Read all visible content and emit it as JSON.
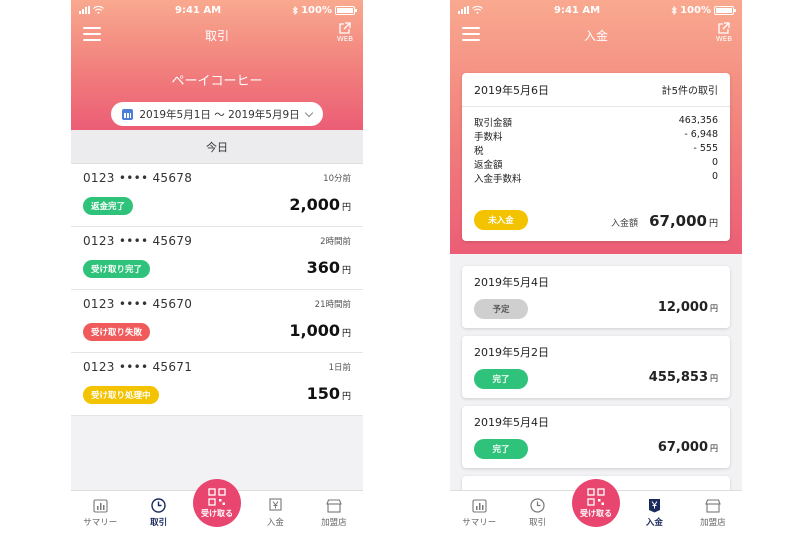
{
  "status": {
    "time": "9:41 AM",
    "battery": "100%"
  },
  "left": {
    "title": "取引",
    "web_label": "WEB",
    "shop_name": "ペーイコーヒー",
    "date_range": "2019年5月1日 〜 2019年5月9日",
    "section": "今日",
    "transactions": [
      {
        "account": "0123  ••••  45678",
        "time": "10分前",
        "status": "返金完了",
        "status_color": "#2fc27a",
        "amount": "2,000",
        "unit": "円"
      },
      {
        "account": "0123  ••••  45679",
        "time": "2時間前",
        "status": "受け取り完了",
        "status_color": "#2fc27a",
        "amount": "360",
        "unit": "円"
      },
      {
        "account": "0123  ••••  45670",
        "time": "21時間前",
        "status": "受け取り失敗",
        "status_color": "#f15a5a",
        "amount": "1,000",
        "unit": "円"
      },
      {
        "account": "0123  ••••  45671",
        "time": "1日前",
        "status": "受け取り処理中",
        "status_color": "#f3c300",
        "amount": "150",
        "unit": "円"
      }
    ]
  },
  "right": {
    "title": "入金",
    "web_label": "WEB",
    "main": {
      "date": "2019年5月6日",
      "count": "計5件の取引",
      "rows": [
        {
          "label": "取引金額",
          "value": "463,356"
        },
        {
          "label": "手数料",
          "value": "- 6,948"
        },
        {
          "label": "税",
          "value": "- 555"
        },
        {
          "label": "返金額",
          "value": "0"
        },
        {
          "label": "入金手数料",
          "value": "0"
        }
      ],
      "status": "未入金",
      "status_color": "#f3c300",
      "total_label": "入金額",
      "total": "67,000",
      "unit": "円"
    },
    "deposits": [
      {
        "date": "2019年5月4日",
        "status": "予定",
        "status_color": "#cfcfcf",
        "status_text_color": "#555",
        "amount": "12,000",
        "unit": "円"
      },
      {
        "date": "2019年5月2日",
        "status": "完了",
        "status_color": "#2fc27a",
        "status_text_color": "#fff",
        "amount": "455,853",
        "unit": "円"
      },
      {
        "date": "2019年5月4日",
        "status": "完了",
        "status_color": "#2fc27a",
        "status_text_color": "#fff",
        "amount": "67,000",
        "unit": "円"
      }
    ]
  },
  "tabs": {
    "summary": "サマリー",
    "transactions": "取引",
    "receive": "受け取る",
    "deposit": "入金",
    "store": "加盟店"
  }
}
